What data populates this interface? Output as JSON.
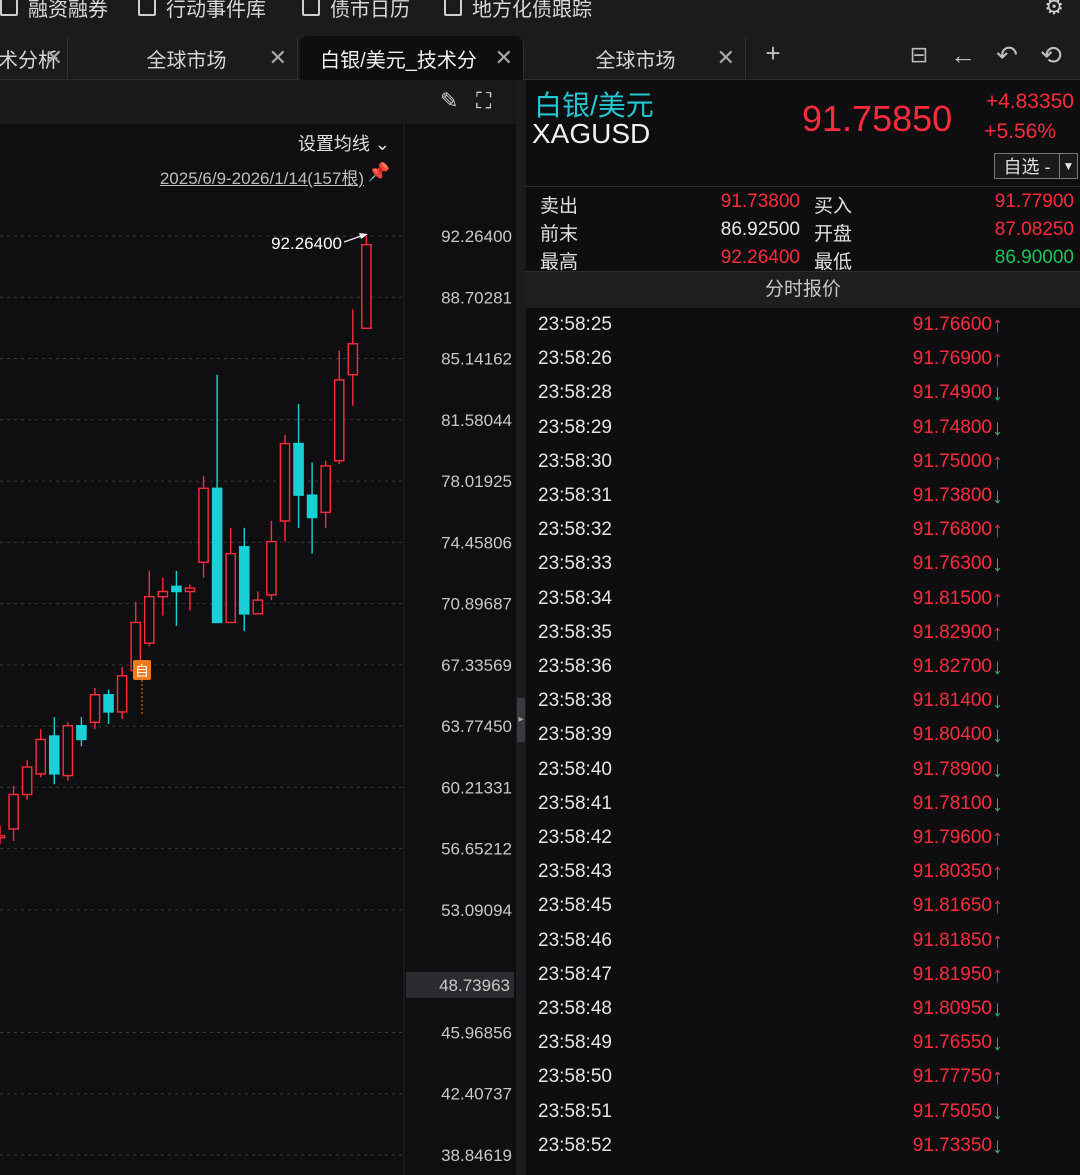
{
  "menu": {
    "items": [
      {
        "label": "融资融券"
      },
      {
        "label": "行动事件库"
      },
      {
        "label": "债市日历"
      },
      {
        "label": "地方化债跟踪"
      }
    ],
    "settings_icon": "gear-icon"
  },
  "tabs": [
    {
      "label": "术分析",
      "active": false
    },
    {
      "label": "全球市场",
      "active": false
    },
    {
      "label": "白银/美元_技术分",
      "active": true
    },
    {
      "label": "全球市场",
      "active": false
    }
  ],
  "tab_close_glyph": "✕",
  "chart": {
    "ma_settings_label": "设置均线 ⌄",
    "date_range": "2025/6/9-2026/1/14(157根)",
    "high_annotation": "92.26400",
    "self_tag": "自",
    "current_price_label": "48.73963",
    "colors": {
      "up": "#ff2b3d",
      "down": "#19d0d6",
      "tag": "#f07a1a"
    }
  },
  "chart_data": {
    "type": "candlestick",
    "y_ticks": [
      "92.26400",
      "88.70281",
      "85.14162",
      "81.58044",
      "78.01925",
      "74.45806",
      "70.89687",
      "67.33569",
      "63.77450",
      "60.21331",
      "56.65212",
      "53.09094",
      "45.96856",
      "42.40737",
      "38.84619"
    ],
    "ylim": [
      38.84619,
      92.264
    ],
    "candles": [
      {
        "o": 57.3,
        "h": 58.0,
        "l": 56.9,
        "c": 57.4
      },
      {
        "o": 57.8,
        "h": 60.3,
        "l": 57.1,
        "c": 59.8
      },
      {
        "o": 59.8,
        "h": 61.8,
        "l": 59.5,
        "c": 61.4
      },
      {
        "o": 61.0,
        "h": 63.6,
        "l": 60.8,
        "c": 63.0
      },
      {
        "o": 63.2,
        "h": 64.3,
        "l": 60.4,
        "c": 61.0
      },
      {
        "o": 60.9,
        "h": 64.0,
        "l": 60.6,
        "c": 63.8
      },
      {
        "o": 63.8,
        "h": 64.3,
        "l": 62.6,
        "c": 63.0
      },
      {
        "o": 64.0,
        "h": 66.0,
        "l": 63.6,
        "c": 65.6
      },
      {
        "o": 65.6,
        "h": 65.9,
        "l": 63.9,
        "c": 64.6
      },
      {
        "o": 64.6,
        "h": 67.2,
        "l": 64.2,
        "c": 66.7
      },
      {
        "o": 67.0,
        "h": 71.0,
        "l": 66.6,
        "c": 69.8
      },
      {
        "o": 68.6,
        "h": 72.8,
        "l": 68.4,
        "c": 71.3
      },
      {
        "o": 71.3,
        "h": 72.4,
        "l": 70.2,
        "c": 71.6
      },
      {
        "o": 71.9,
        "h": 72.8,
        "l": 69.6,
        "c": 71.6
      },
      {
        "o": 71.6,
        "h": 72.0,
        "l": 70.5,
        "c": 71.8
      },
      {
        "o": 73.3,
        "h": 78.3,
        "l": 72.4,
        "c": 77.6
      },
      {
        "o": 77.6,
        "h": 84.2,
        "l": 70.6,
        "c": 69.8
      },
      {
        "o": 69.8,
        "h": 75.3,
        "l": 69.8,
        "c": 73.8
      },
      {
        "o": 74.2,
        "h": 75.3,
        "l": 69.3,
        "c": 70.3
      },
      {
        "o": 70.3,
        "h": 71.6,
        "l": 70.3,
        "c": 71.1
      },
      {
        "o": 71.4,
        "h": 75.7,
        "l": 71.1,
        "c": 74.5
      },
      {
        "o": 75.7,
        "h": 80.7,
        "l": 74.5,
        "c": 80.2
      },
      {
        "o": 80.2,
        "h": 82.5,
        "l": 75.3,
        "c": 77.2
      },
      {
        "o": 77.2,
        "h": 79.1,
        "l": 73.8,
        "c": 75.9
      },
      {
        "o": 76.2,
        "h": 79.2,
        "l": 75.3,
        "c": 78.9
      },
      {
        "o": 79.2,
        "h": 85.6,
        "l": 79.0,
        "c": 83.9
      },
      {
        "o": 84.2,
        "h": 88.0,
        "l": 82.4,
        "c": 86.0
      },
      {
        "o": 86.9,
        "h": 92.264,
        "l": 86.9,
        "c": 91.7585
      }
    ]
  },
  "quote": {
    "name_cn": "白银/美元",
    "code": "XAGUSD",
    "last": "91.75850",
    "change": "+4.83350",
    "change_pct": "+5.56%",
    "watch_label": "自选 -",
    "stats": [
      {
        "label": "卖出",
        "value": "91.73800",
        "label2": "买入",
        "value2": "91.77900",
        "color": "#ff2b3d",
        "color2": "#ff2b3d"
      },
      {
        "label": "前末",
        "value": "86.92500",
        "label2": "开盘",
        "value2": "87.08250",
        "color": "#e6e6e6",
        "color2": "#ff2b3d"
      },
      {
        "label": "最高",
        "value": "92.26400",
        "label2": "最低",
        "value2": "86.90000",
        "color": "#ff2b3d",
        "color2": "#1fc25a"
      }
    ],
    "ticks_title": "分时报价",
    "ticks": [
      {
        "time": "23:58:25",
        "price": "91.76600",
        "dir": "up"
      },
      {
        "time": "23:58:26",
        "price": "91.76900",
        "dir": "up"
      },
      {
        "time": "23:58:28",
        "price": "91.74900",
        "dir": "down"
      },
      {
        "time": "23:58:29",
        "price": "91.74800",
        "dir": "down"
      },
      {
        "time": "23:58:30",
        "price": "91.75000",
        "dir": "up"
      },
      {
        "time": "23:58:31",
        "price": "91.73800",
        "dir": "down"
      },
      {
        "time": "23:58:32",
        "price": "91.76800",
        "dir": "up"
      },
      {
        "time": "23:58:33",
        "price": "91.76300",
        "dir": "down"
      },
      {
        "time": "23:58:34",
        "price": "91.81500",
        "dir": "up"
      },
      {
        "time": "23:58:35",
        "price": "91.82900",
        "dir": "up"
      },
      {
        "time": "23:58:36",
        "price": "91.82700",
        "dir": "down"
      },
      {
        "time": "23:58:38",
        "price": "91.81400",
        "dir": "down"
      },
      {
        "time": "23:58:39",
        "price": "91.80400",
        "dir": "down"
      },
      {
        "time": "23:58:40",
        "price": "91.78900",
        "dir": "down"
      },
      {
        "time": "23:58:41",
        "price": "91.78100",
        "dir": "down"
      },
      {
        "time": "23:58:42",
        "price": "91.79600",
        "dir": "up"
      },
      {
        "time": "23:58:43",
        "price": "91.80350",
        "dir": "up"
      },
      {
        "time": "23:58:45",
        "price": "91.81650",
        "dir": "up"
      },
      {
        "time": "23:58:46",
        "price": "91.81850",
        "dir": "up"
      },
      {
        "time": "23:58:47",
        "price": "91.81950",
        "dir": "up"
      },
      {
        "time": "23:58:48",
        "price": "91.80950",
        "dir": "down"
      },
      {
        "time": "23:58:49",
        "price": "91.76550",
        "dir": "down"
      },
      {
        "time": "23:58:50",
        "price": "91.77750",
        "dir": "up"
      },
      {
        "time": "23:58:51",
        "price": "91.75050",
        "dir": "down"
      },
      {
        "time": "23:58:52",
        "price": "91.73350",
        "dir": "down"
      }
    ],
    "arrow_up": "🠕",
    "arrow_down": "🠗"
  }
}
